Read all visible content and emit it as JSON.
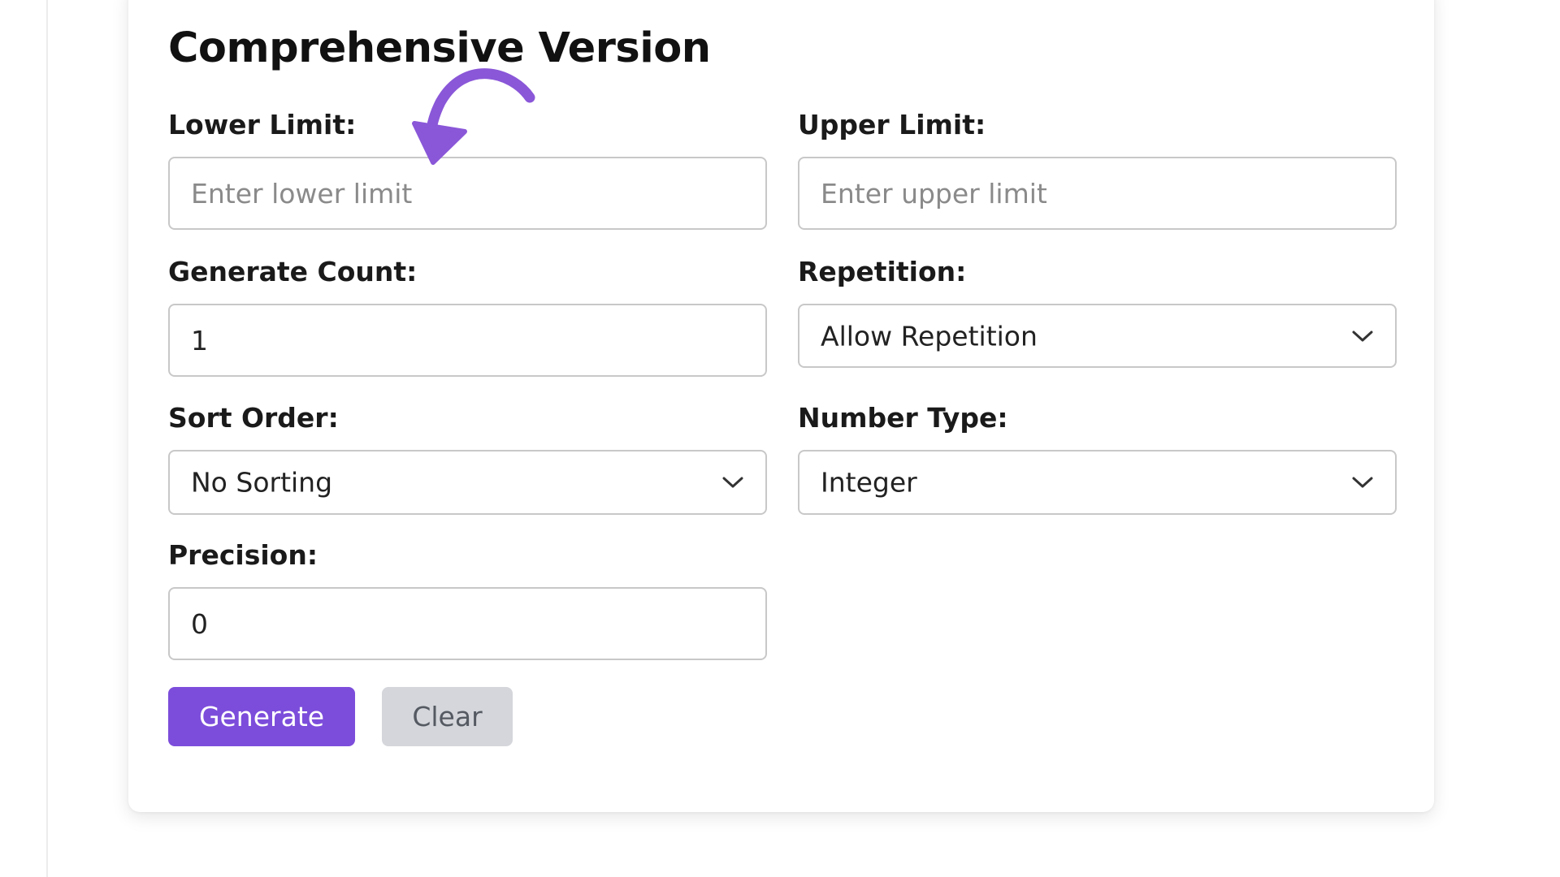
{
  "form": {
    "title": "Comprehensive Version",
    "lower_limit": {
      "label": "Lower Limit:",
      "placeholder": "Enter lower limit",
      "value": ""
    },
    "upper_limit": {
      "label": "Upper Limit:",
      "placeholder": "Enter upper limit",
      "value": ""
    },
    "generate_count": {
      "label": "Generate Count:",
      "value": "1"
    },
    "repetition": {
      "label": "Repetition:",
      "selected": "Allow Repetition"
    },
    "sort_order": {
      "label": "Sort Order:",
      "selected": "No Sorting"
    },
    "number_type": {
      "label": "Number Type:",
      "selected": "Integer"
    },
    "precision": {
      "label": "Precision:",
      "value": "0"
    },
    "buttons": {
      "generate_label": "Generate",
      "clear_label": "Clear"
    }
  },
  "colors": {
    "accent": "#7c4ddb",
    "annotation_arrow": "#8a57d8",
    "secondary_button": "#d4d6db",
    "field_border": "#c8c8c8"
  },
  "icons": {
    "select_chevron": "chevron-down-icon",
    "annotation": "curved-arrow-icon"
  }
}
